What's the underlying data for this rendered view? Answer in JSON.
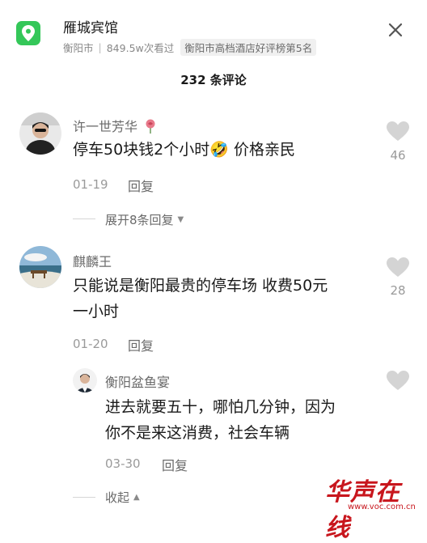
{
  "header": {
    "title": "雁城宾馆",
    "city": "衡阳市",
    "views": "849.5w次看过",
    "rank": "衡阳市高档酒店好评榜第5名",
    "close_icon": "close-icon"
  },
  "comments_count": "232 条评论",
  "comments": [
    {
      "user": "许一世芳华",
      "text": "停车50块钱2个小时🤣 价格亲民",
      "date": "01-19",
      "reply_label": "回复",
      "likes": "46",
      "toggle": "展开8条回复"
    },
    {
      "user": "麒麟王",
      "text_line1": "只能说是衡阳最贵的停车场 收费50元",
      "text_line2": "一小时",
      "date": "01-20",
      "reply_label": "回复",
      "likes": "28",
      "reply": {
        "user": "衡阳盆鱼宴",
        "text_line1": "进去就要五十，哪怕几分钟，因为",
        "text_line2": "你不是来这消费，社会车辆",
        "date": "03-30",
        "reply_label": "回复"
      },
      "toggle": "收起"
    }
  ],
  "watermark": {
    "text": "华声在线",
    "url": "www.voc.com.cn"
  },
  "colors": {
    "location_icon": "#34c759",
    "watermark": "#c8161d"
  }
}
